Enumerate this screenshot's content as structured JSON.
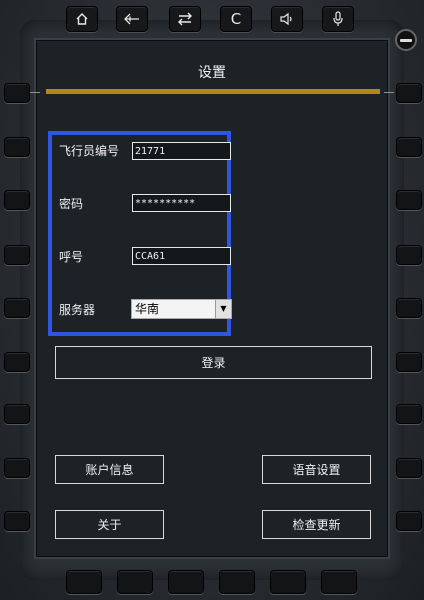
{
  "toolbar": {
    "home_icon": "home-icon",
    "back_icon": "back-arrow-icon",
    "swap_icon": "swap-icon",
    "clear_label": "C",
    "volume_icon": "speaker-icon",
    "mic_icon": "microphone-icon"
  },
  "screen": {
    "title": "设置",
    "accent_color": "#b8841c",
    "highlight_color": "#2f56e0"
  },
  "form": {
    "pilot_id_label": "飞行员编号",
    "pilot_id_value": "21771",
    "password_label": "密码",
    "password_value": "**********",
    "callsign_label": "呼号",
    "callsign_value": "CCA61",
    "server_label": "服务器",
    "server_value": "华南"
  },
  "buttons": {
    "login": "登录",
    "account_info": "账户信息",
    "voice_settings": "语音设置",
    "about": "关于",
    "check_updates": "检查更新"
  }
}
